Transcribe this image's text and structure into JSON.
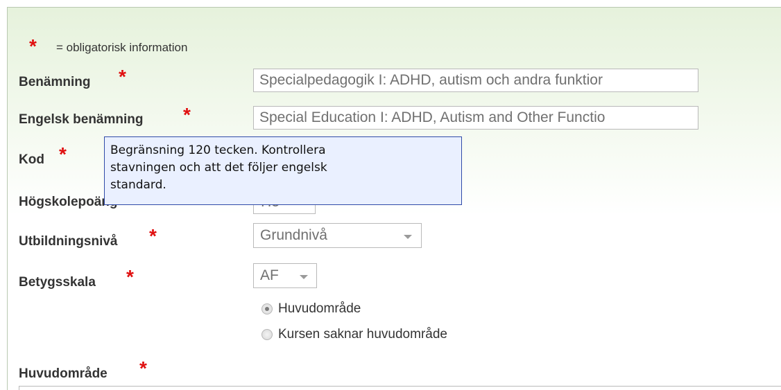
{
  "legend": {
    "star": "*",
    "text": "= obligatorisk information"
  },
  "fields": {
    "benamning": {
      "label": "Benämning",
      "value": "Specialpedagogik I: ADHD, autism och andra funktior"
    },
    "engelsk": {
      "label": "Engelsk benämning",
      "value": "Special Education I: ADHD, Autism and Other Functio"
    },
    "kod": {
      "label": "Kod"
    },
    "hogskolepoang": {
      "label": "Högskolepoäng",
      "value": "7.5"
    },
    "utbildningsniva": {
      "label": "Utbildningsnivå",
      "selected": "Grundnivå"
    },
    "betygsskala": {
      "label": "Betygsskala",
      "selected": "AF"
    },
    "huvudomrade": {
      "label": "Huvudområde"
    }
  },
  "radios": [
    {
      "label": "Huvudområde",
      "checked": true
    },
    {
      "label": "Kursen saknar huvudområde",
      "checked": false
    }
  ],
  "tooltip": {
    "text": "Begränsning 120 tecken. Kontrollera\nstavningen och att det följer engelsk\nstandard."
  },
  "required_mark": "*"
}
